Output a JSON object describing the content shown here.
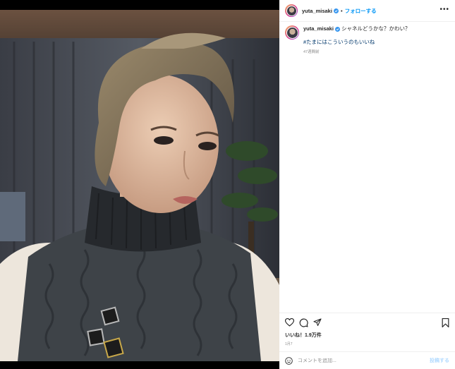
{
  "post": {
    "username": "yuta_misaki",
    "follow_label": "フォローする",
    "separator": "•",
    "more_label": "•••",
    "caption_text": "シャネルどうかな？かわい？",
    "hashtag": "#たまにはこういうのもいいね",
    "caption_time": "47週間前",
    "likes": "いいね！1.9万件",
    "post_date": "1月7",
    "comment_placeholder": "コメントを追加...",
    "post_button": "投稿する"
  },
  "icons": {
    "verified": "verified-badge-icon",
    "like": "heart-icon",
    "comment": "comment-icon",
    "share": "share-icon",
    "save": "bookmark-icon",
    "emoji": "emoji-icon"
  },
  "colors": {
    "accent": "#0095f6",
    "verified": "#3897f0",
    "hashtag": "#00376b",
    "muted": "#8e8e8e",
    "post_disabled": "#b3dbff"
  }
}
